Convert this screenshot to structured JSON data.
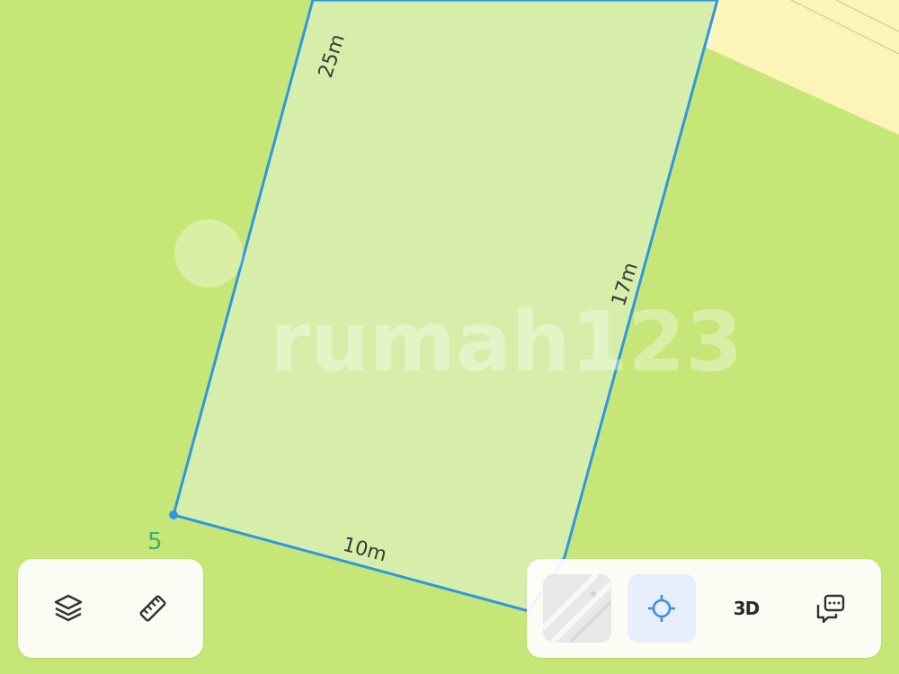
{
  "map": {
    "edge_labels": {
      "top_left": "25m",
      "right": "17m",
      "bottom": "10m"
    },
    "vertex_label": "5",
    "watermark_text": "rumah123",
    "colors": {
      "grass": "#c6e677",
      "plot_fill": "#d6eeaa",
      "boundary": "#2f97e0",
      "road": "#fdf4b8"
    }
  },
  "controls": {
    "left": [
      {
        "name": "layers",
        "icon": "layers-icon"
      },
      {
        "name": "measure",
        "icon": "ruler-icon"
      }
    ],
    "right": [
      {
        "name": "satellite",
        "icon": "satellite-thumbnail"
      },
      {
        "name": "locate",
        "icon": "crosshair-icon"
      },
      {
        "name": "3d",
        "label": "3D"
      },
      {
        "name": "street-view",
        "icon": "street-view-icon"
      }
    ]
  }
}
